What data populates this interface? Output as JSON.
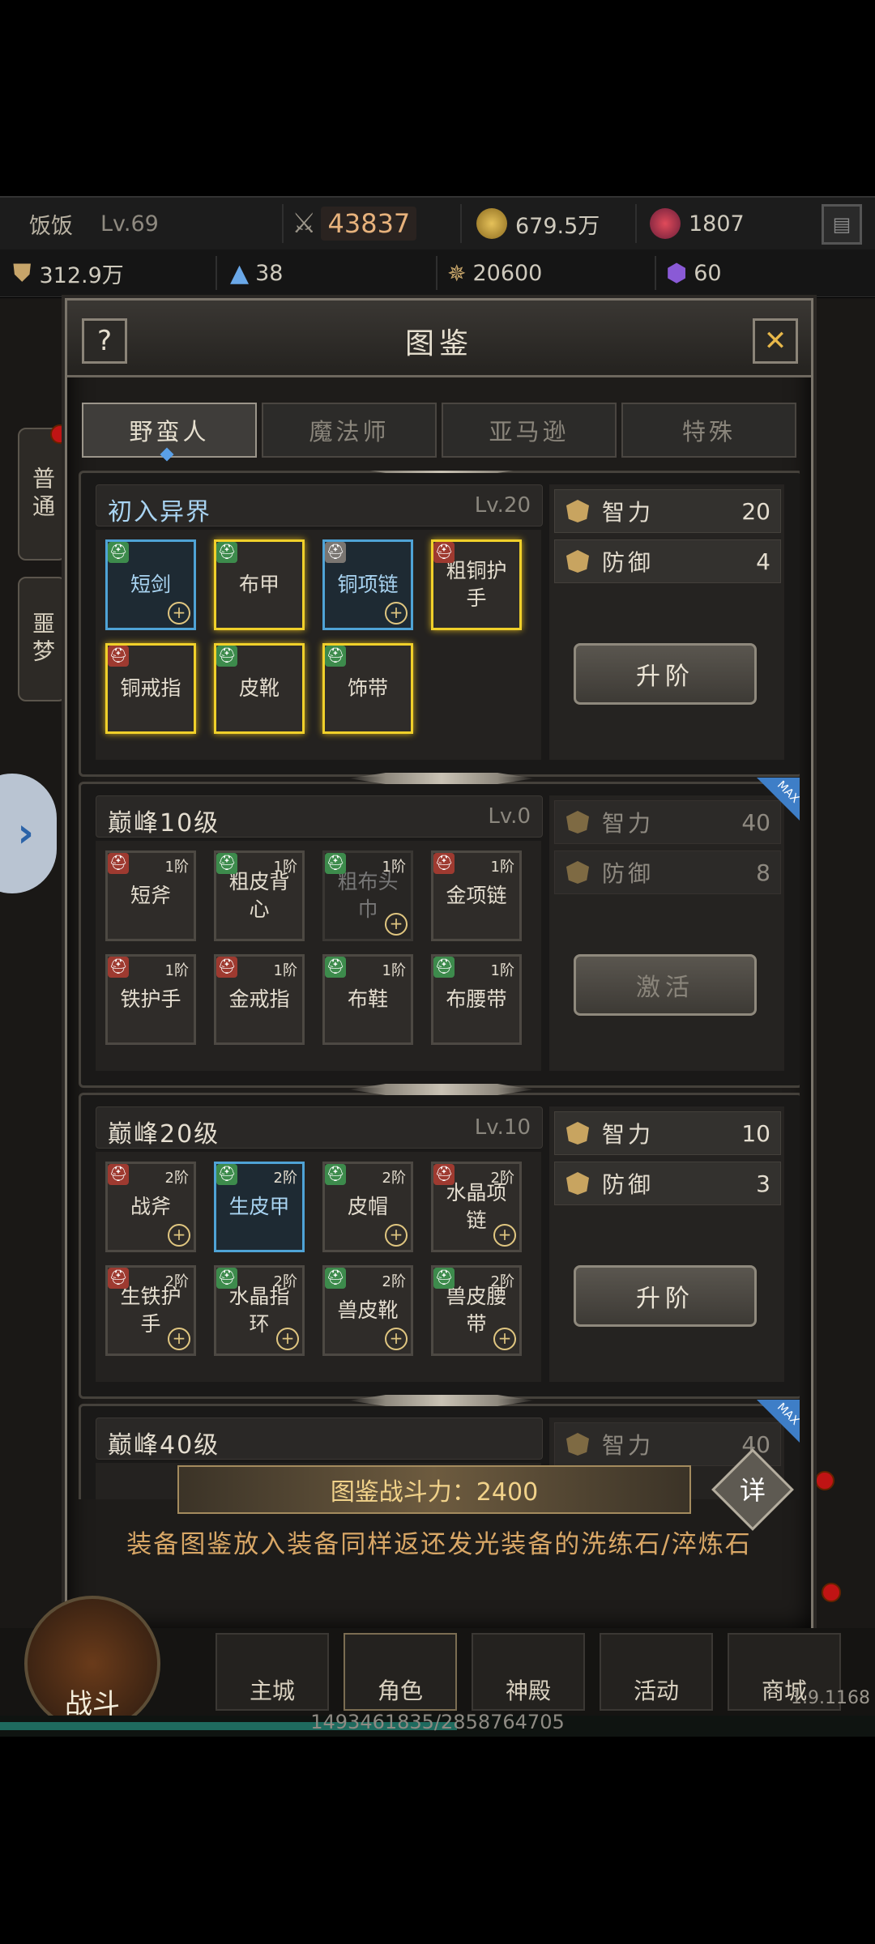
{
  "player": {
    "name": "饭饭",
    "level": "Lv.69"
  },
  "topbar": {
    "power": "43837",
    "gold": "679.5万",
    "gems": "1807",
    "exp": "312.9万",
    "crystal": "38",
    "honor": "20600",
    "shards": "60"
  },
  "side_tabs": [
    "普通",
    "噩梦"
  ],
  "dialog": {
    "title": "图鉴",
    "help": "?",
    "close": "✕",
    "tabs": [
      "野蛮人",
      "魔法师",
      "亚马逊",
      "特殊"
    ]
  },
  "sections": [
    {
      "title": "初入异界",
      "level": "Lv.20",
      "items": [
        {
          "name": "短剑",
          "badge": "g",
          "style": "blue",
          "plus": true,
          "tier": ""
        },
        {
          "name": "布甲",
          "badge": "g",
          "style": "gold",
          "plus": false,
          "tier": ""
        },
        {
          "name": "铜项链",
          "badge": "w",
          "style": "blue",
          "plus": true,
          "tier": ""
        },
        {
          "name": "粗铜护手",
          "badge": "r",
          "style": "gold",
          "plus": false,
          "tier": ""
        },
        {
          "name": "铜戒指",
          "badge": "r",
          "style": "gold",
          "plus": false,
          "tier": ""
        },
        {
          "name": "皮靴",
          "badge": "g",
          "style": "gold",
          "plus": false,
          "tier": ""
        },
        {
          "name": "饰带",
          "badge": "g",
          "style": "gold",
          "plus": false,
          "tier": ""
        }
      ],
      "stats": [
        {
          "name": "智力",
          "value": "20"
        },
        {
          "name": "防御",
          "value": "4"
        }
      ],
      "button": "升阶",
      "dim": false,
      "max": false
    },
    {
      "title": "巅峰10级",
      "level": "Lv.0",
      "items": [
        {
          "name": "短斧",
          "badge": "r",
          "style": "",
          "plus": false,
          "tier": "1阶"
        },
        {
          "name": "粗皮背心",
          "badge": "g",
          "style": "",
          "plus": false,
          "tier": "1阶"
        },
        {
          "name": "粗布头巾",
          "badge": "g",
          "style": "dim",
          "plus": true,
          "tier": "1阶"
        },
        {
          "name": "金项链",
          "badge": "r",
          "style": "",
          "plus": false,
          "tier": "1阶"
        },
        {
          "name": "铁护手",
          "badge": "r",
          "style": "",
          "plus": false,
          "tier": "1阶"
        },
        {
          "name": "金戒指",
          "badge": "r",
          "style": "",
          "plus": false,
          "tier": "1阶"
        },
        {
          "name": "布鞋",
          "badge": "g",
          "style": "",
          "plus": false,
          "tier": "1阶"
        },
        {
          "name": "布腰带",
          "badge": "g",
          "style": "",
          "plus": false,
          "tier": "1阶"
        }
      ],
      "stats": [
        {
          "name": "智力",
          "value": "40"
        },
        {
          "name": "防御",
          "value": "8"
        }
      ],
      "button": "激活",
      "dim": true,
      "max": true
    },
    {
      "title": "巅峰20级",
      "level": "Lv.10",
      "items": [
        {
          "name": "战斧",
          "badge": "r",
          "style": "",
          "plus": true,
          "tier": "2阶"
        },
        {
          "name": "生皮甲",
          "badge": "g",
          "style": "blue",
          "plus": false,
          "tier": "2阶"
        },
        {
          "name": "皮帽",
          "badge": "g",
          "style": "",
          "plus": true,
          "tier": "2阶"
        },
        {
          "name": "水晶项链",
          "badge": "r",
          "style": "",
          "plus": true,
          "tier": "2阶"
        },
        {
          "name": "生铁护手",
          "badge": "r",
          "style": "",
          "plus": true,
          "tier": "2阶"
        },
        {
          "name": "水晶指环",
          "badge": "g",
          "style": "",
          "plus": true,
          "tier": "2阶"
        },
        {
          "name": "兽皮靴",
          "badge": "g",
          "style": "",
          "plus": true,
          "tier": "2阶"
        },
        {
          "name": "兽皮腰带",
          "badge": "g",
          "style": "",
          "plus": true,
          "tier": "2阶"
        }
      ],
      "stats": [
        {
          "name": "智力",
          "value": "10"
        },
        {
          "name": "防御",
          "value": "3"
        }
      ],
      "button": "升阶",
      "dim": false,
      "max": false
    },
    {
      "title": "巅峰40级",
      "level": "",
      "items": [],
      "stats": [
        {
          "name": "智力",
          "value": "40"
        }
      ],
      "button": "",
      "dim": true,
      "max": true
    }
  ],
  "footer": {
    "power_label": "图鉴战斗力：2400",
    "detail": "详",
    "hint": "装备图鉴放入装备同样返还发光装备的洗练石/淬炼石"
  },
  "nav": {
    "fight": "战斗",
    "items": [
      "主城",
      "角色",
      "神殿",
      "活动",
      "商城"
    ],
    "version": "1.9.1168"
  },
  "progress": {
    "text": "1493461835/2858764705",
    "fraction": 0.522
  }
}
